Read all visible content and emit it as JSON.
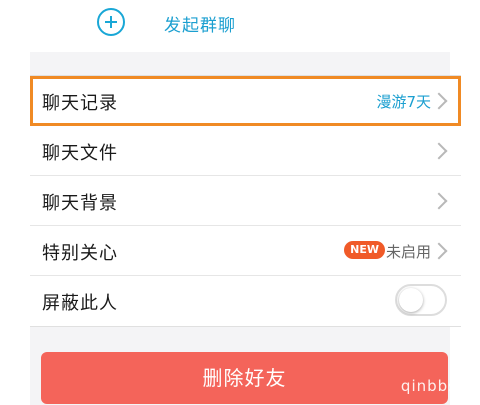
{
  "top": {
    "add_icon": "plus-circle-icon",
    "label": "发起群聊"
  },
  "rows": [
    {
      "label": "聊天记录",
      "value": "漫游7天",
      "icon": "chevron-right-icon"
    },
    {
      "label": "聊天文件",
      "icon": "chevron-right-icon"
    },
    {
      "label": "聊天背景",
      "icon": "chevron-right-icon"
    },
    {
      "label": "特别关心",
      "badge": "NEW",
      "value": "未启用",
      "icon": "chevron-right-icon"
    },
    {
      "label": "屏蔽此人",
      "toggle_on": false
    }
  ],
  "delete_button": "删除好友",
  "watermark": "qinbbs.c",
  "colors": {
    "accent": "#1b9fd0",
    "highlight": "#f08a24",
    "badge": "#f05a28",
    "danger": "#f4645a"
  }
}
